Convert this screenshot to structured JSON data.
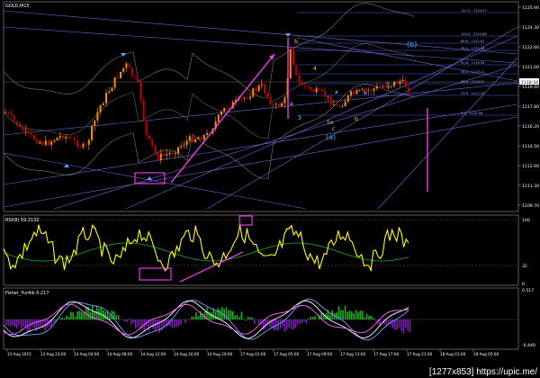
{
  "main": {
    "title": "GOLD,M15",
    "price_ticks": [
      "1125.90",
      "1124.30",
      "1122.60",
      "1121.00",
      "1119.40",
      "1117.80",
      "1116.20",
      "1114.50",
      "1112.90",
      "1111.30",
      "1109.70"
    ],
    "current_price": "1118.34",
    "fibo_levels": [
      {
        "label": "127.2 - 1124.57"
      },
      {
        "label": "100.0 - 1122.64"
      },
      {
        "label": "88.6 - 1121.81"
      },
      {
        "label": "76.4 - 1120.98"
      },
      {
        "label": "61.8 - 1119.94"
      },
      {
        "label": "50.0 - 1119.11"
      },
      {
        "label": "38.2 - 1118.27"
      },
      {
        "label": "23.6 - 1117.23"
      },
      {
        "label": "0.0 - 1115.56"
      }
    ],
    "annotations": [
      "b",
      "4",
      "a",
      "3",
      "5x",
      "c",
      "b",
      "(a)",
      "(b)",
      "a",
      "b",
      "3"
    ]
  },
  "rsi": {
    "title": "RSI(8) 59.2132",
    "ticks": [
      "100",
      "32",
      "0"
    ]
  },
  "fisher": {
    "title": "Fisher_Yur4ik 0.217",
    "ticks": [
      "0.517",
      "-0.440"
    ]
  },
  "time_axis": [
    "13 Aug 2015",
    "13 Aug 23:00",
    "14 Aug 04:00",
    "14 Aug 08:00",
    "14 Aug 12:00",
    "14 Aug 16:00",
    "14 Aug 20:00",
    "17 Aug 01:00",
    "17 Aug 05:00",
    "17 Aug 09:00",
    "17 Aug 13:00",
    "17 Aug 17:00",
    "17 Aug 21:00",
    "18 Aug 01:00",
    "18 Aug 05:00"
  ],
  "watermark": "[1277x853] https://upic.me/",
  "colors": {
    "bull": "#ff8a00",
    "bear": "#c00000",
    "rsi": "#ffff00",
    "rsi_ma": "#22aa22",
    "trend": "#ff3cff",
    "grid_line": "#6b6bd6",
    "fibo": "#4a5fe8"
  }
}
